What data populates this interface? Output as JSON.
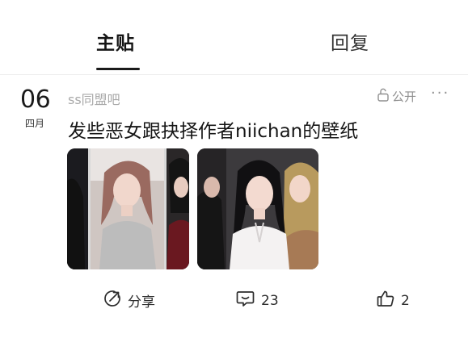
{
  "tabs": [
    {
      "label": "主贴"
    },
    {
      "label": "回复"
    }
  ],
  "post": {
    "day": "06",
    "month": "四月",
    "forum": "ss同盟吧",
    "visibility": "公开",
    "more": "···",
    "title": "发些恶女跟抉择作者niichan的壁纸",
    "images": [
      {
        "icon": "image-thumbnail"
      },
      {
        "icon": "image-thumbnail"
      }
    ]
  },
  "actions": {
    "share_label": "分享",
    "comment_count": "23",
    "like_count": "2"
  }
}
